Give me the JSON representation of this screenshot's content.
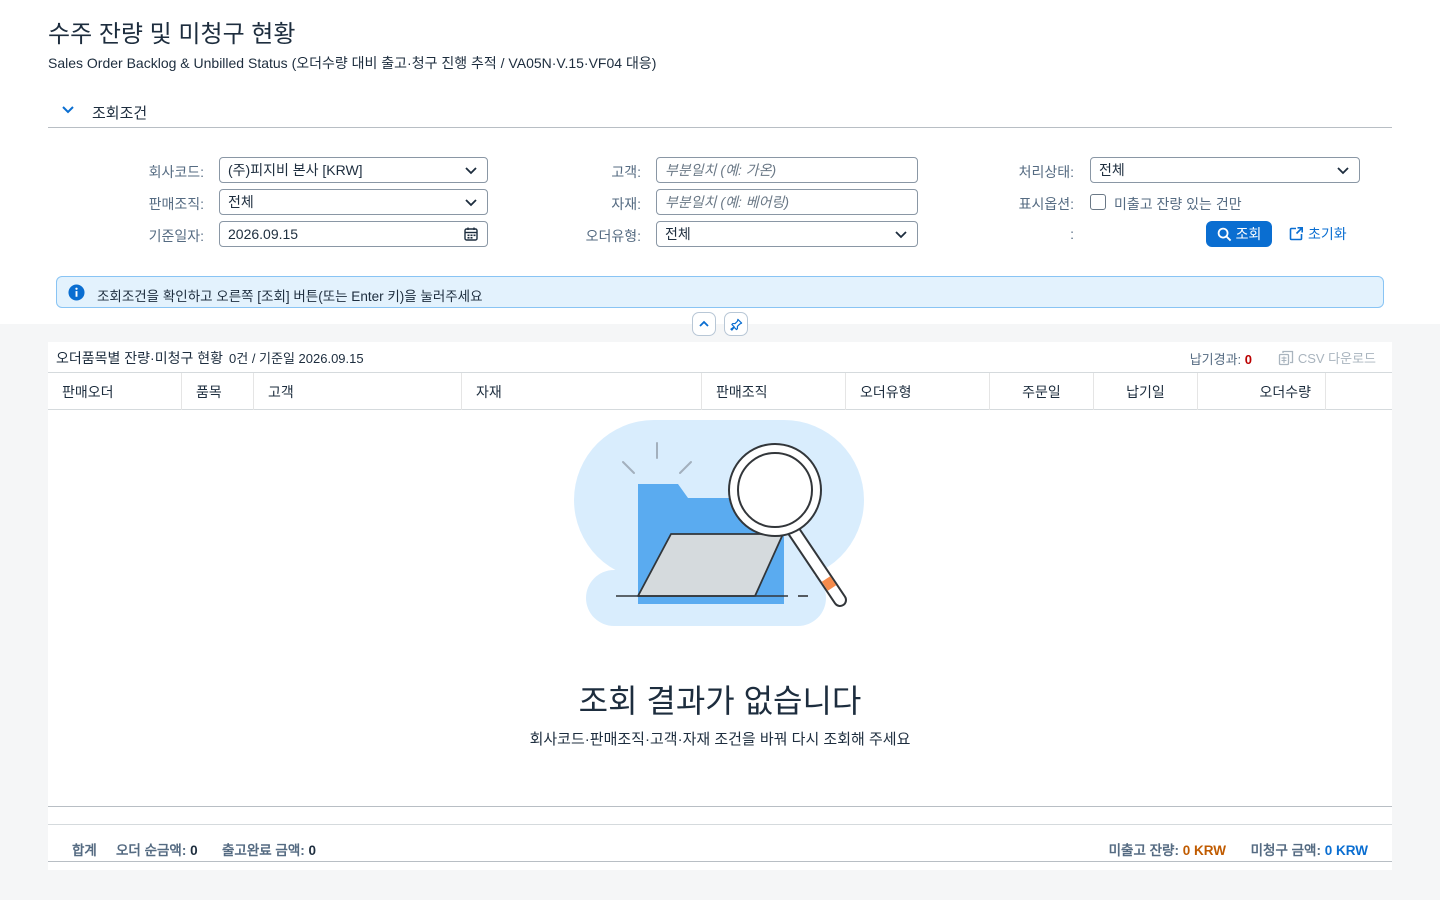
{
  "page": {
    "title": "수주 잔량 및 미청구 현황",
    "subtitle": "Sales Order Backlog & Unbilled Status (오더수량 대비 출고·청구 진행 추적 / VA05N·V.15·VF04 대응)"
  },
  "filters": {
    "section_label": "조회조건",
    "company_code": {
      "label": "회사코드:",
      "value": "(주)피지비 본사 [KRW]"
    },
    "sales_org": {
      "label": "판매조직:",
      "value": "전체"
    },
    "base_date": {
      "label": "기준일자:",
      "value": "2026.09.15"
    },
    "customer": {
      "label": "고객:",
      "placeholder": "부분일치 (예: 가온)"
    },
    "material": {
      "label": "자재:",
      "placeholder": "부분일치 (예: 베어링)"
    },
    "order_type": {
      "label": "오더유형:",
      "value": "전체"
    },
    "status": {
      "label": "처리상태:",
      "value": "전체"
    },
    "display_option": {
      "label": "표시옵션:",
      "checkbox_label": "미출고 잔량 있는 건만",
      "checked": false
    },
    "empty_label": ":",
    "search_button": "조회",
    "reset_button": "초기화"
  },
  "info_strip": {
    "text": "조회조건을 확인하고 오른쪽 [조회] 버튼(또는 Enter 키)을 눌러주세요"
  },
  "table": {
    "title": "오더품목별 잔량·미청구 현황",
    "count_text": "0건 / 기준일 2026.09.15",
    "delivery_label": "납기경과:",
    "delivery_value": "0",
    "csv_label": "CSV 다운로드",
    "columns": [
      "판매오더",
      "품목",
      "고객",
      "자재",
      "판매조직",
      "오더유형",
      "주문일",
      "납기일",
      "오더수량"
    ],
    "empty_title": "조회 결과가 없습니다",
    "empty_sub": "회사코드·판매조직·고객·자재 조건을 바꿔 다시 조회해 주세요"
  },
  "totals": {
    "label": "합계",
    "net_label": "오더 순금액:",
    "net_value": "0",
    "shipped_label": "출고완료 금액:",
    "shipped_value": "0",
    "backlog_label": "미출고 잔량:",
    "backlog_value": "0 KRW",
    "unbilled_label": "미청구 금액:",
    "unbilled_value": "0 KRW"
  },
  "colors": {
    "brand_blue": "#0a6ed1",
    "info_bg": "#e3f2fd",
    "overdue_red": "#bb0000",
    "backlog_orange": "#c05b00"
  }
}
